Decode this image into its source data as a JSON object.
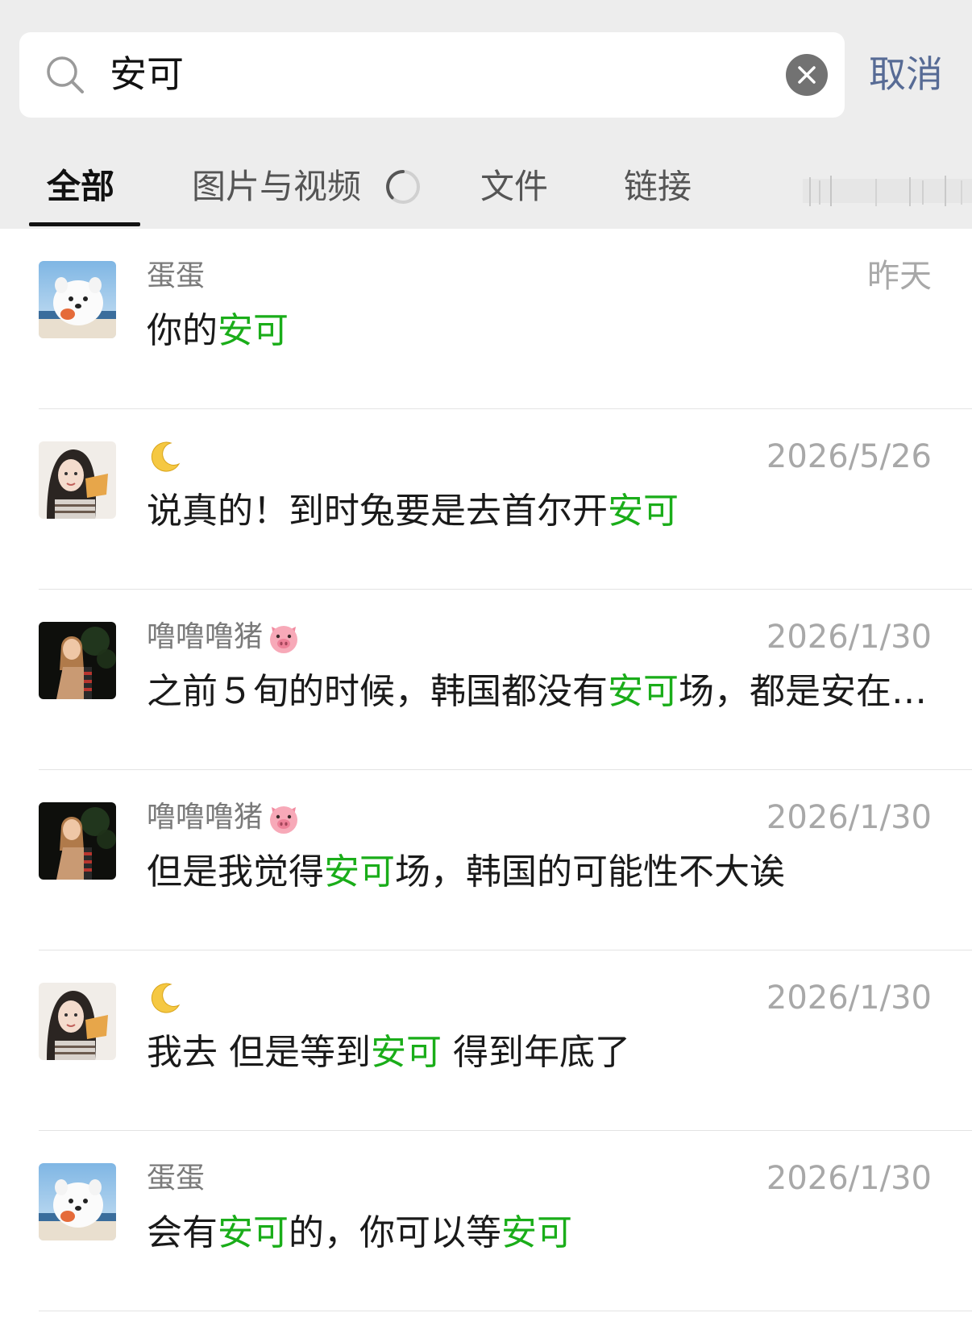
{
  "search": {
    "query": "安可",
    "cancel_label": "取消"
  },
  "tabs": [
    {
      "label": "全部",
      "active": true
    },
    {
      "label": "图片与视频",
      "active": false,
      "loading": true
    },
    {
      "label": "文件",
      "active": false
    },
    {
      "label": "链接",
      "active": false
    }
  ],
  "colors": {
    "highlight": "#1aad19",
    "link": "#576b95",
    "background": "#ededed"
  },
  "results": [
    {
      "avatar": "samoyed-avatar",
      "name": "蛋蛋",
      "name_icon": "",
      "time": "昨天",
      "message": {
        "p1": "你的",
        "h1": "安可",
        "p2": "",
        "h2": "",
        "p3": ""
      }
    },
    {
      "avatar": "girl-snack-avatar",
      "name": "",
      "name_icon": "crescent-moon-icon",
      "time": "2026/5/26",
      "message": {
        "p1": "说真的！到时兔要是去首尔开",
        "h1": "安可",
        "p2": "",
        "h2": "",
        "p3": ""
      }
    },
    {
      "avatar": "night-girl-avatar",
      "name": "噜噜噜猪",
      "name_icon": "pig-face-icon",
      "time": "2026/1/30",
      "message": {
        "p1": "之前５旬的时候，韩国都没有",
        "h1": "安可",
        "p2": "场，都是安在…",
        "h2": "",
        "p3": ""
      }
    },
    {
      "avatar": "night-girl-avatar",
      "name": "噜噜噜猪",
      "name_icon": "pig-face-icon",
      "time": "2026/1/30",
      "message": {
        "p1": "但是我觉得",
        "h1": "安可",
        "p2": "场，韩国的可能性不大诶",
        "h2": "",
        "p3": ""
      }
    },
    {
      "avatar": "girl-snack-avatar",
      "name": "",
      "name_icon": "crescent-moon-icon",
      "time": "2026/1/30",
      "message": {
        "p1": "我去 但是等到",
        "h1": "安可",
        "p2": " 得到年底了",
        "h2": "",
        "p3": ""
      }
    },
    {
      "avatar": "samoyed-avatar",
      "name": "蛋蛋",
      "name_icon": "",
      "time": "2026/1/30",
      "message": {
        "p1": "会有",
        "h1": "安可",
        "p2": "的，你可以等",
        "h2": "安可",
        "p3": ""
      }
    }
  ]
}
